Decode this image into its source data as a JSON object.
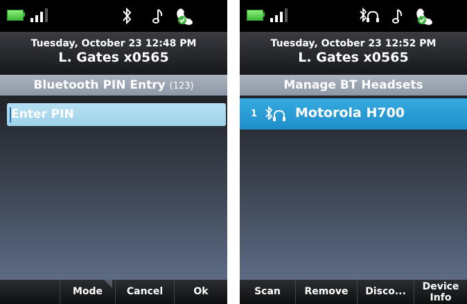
{
  "left_screen": {
    "status": {
      "battery": "battery-icon",
      "signal": "signal-icon",
      "icons": [
        "bluetooth-icon",
        "ringer-music-note-icon",
        "hook-handset-check-icon"
      ]
    },
    "header": {
      "datetime": "Tuesday, October 23 12:48 PM",
      "user_line": "L. Gates x0565"
    },
    "title": "Bluetooth PIN Entry",
    "title_hint": "(123)",
    "pin_field": {
      "placeholder": "Enter PIN",
      "value": ""
    },
    "softkeys": [
      "",
      "Mode",
      "Cancel",
      "Ok"
    ]
  },
  "right_screen": {
    "status": {
      "battery": "battery-icon",
      "signal": "signal-icon",
      "icons": [
        "bluetooth-headset-icon",
        "ringer-music-note-icon",
        "hook-handset-check-icon"
      ]
    },
    "header": {
      "datetime": "Tuesday, October 23 12:52 PM",
      "user_line": "L. Gates x0565"
    },
    "title": "Manage BT Headsets",
    "list": [
      {
        "index": "1",
        "icon": "bluetooth-headset-icon",
        "label": "Motorola H700"
      }
    ],
    "softkeys": [
      "Scan",
      "Remove",
      "Disco...",
      "Device",
      "Info"
    ]
  },
  "colors": {
    "selection": "#1f8fcb",
    "title_bar": "#9aa3b1",
    "battery": "#3bb93a"
  }
}
